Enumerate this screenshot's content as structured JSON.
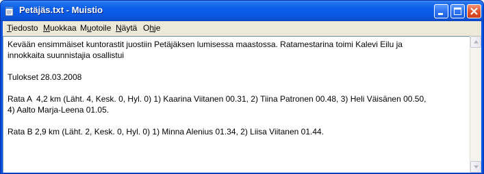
{
  "window": {
    "title": "Petäjäs.txt - Muistio",
    "icons": {
      "app": "notepad-icon",
      "minimize": "minimize-icon",
      "maximize": "maximize-icon",
      "close": "close-icon"
    }
  },
  "menu": {
    "items": [
      {
        "accel": "T",
        "rest": "iedosto"
      },
      {
        "accel": "M",
        "rest": "uokkaa"
      },
      {
        "pre": "M",
        "accel": "u",
        "rest": "otoile"
      },
      {
        "accel": "N",
        "rest": "äytä"
      },
      {
        "pre": "O",
        "accel": "h",
        "rest": "je"
      }
    ]
  },
  "document": {
    "lines": [
      "Kevään ensimmäiset kuntorastit juostiin Petäjäksen lumisessa maastossa. Ratamestarina toimi Kalevi Eilu ja",
      "innokkaita suunnistajia osallistui",
      "",
      "Tulokset 28.03.2008",
      "",
      "Rata A  4,2 km (Läht. 4, Kesk. 0, Hyl. 0) 1) Kaarina Viitanen 00.31, 2) Tiina Patronen 00.48, 3) Heli Väisänen 00.50,",
      "4) Aalto Marja-Leena 01.05.",
      "",
      "Rata B 2,9 km (Läht. 2, Kesk. 0, Hyl. 0) 1) Minna Alenius 01.34, 2) Liisa Viitanen 01.44."
    ]
  },
  "scrollbar": {
    "icons": {
      "up": "arrow-up-icon",
      "down": "arrow-down-icon"
    }
  },
  "colors": {
    "titlebar": "#0a58e2",
    "frame": "#0a53e0",
    "close_button": "#e2562e",
    "menubar": "#ece9d8"
  }
}
